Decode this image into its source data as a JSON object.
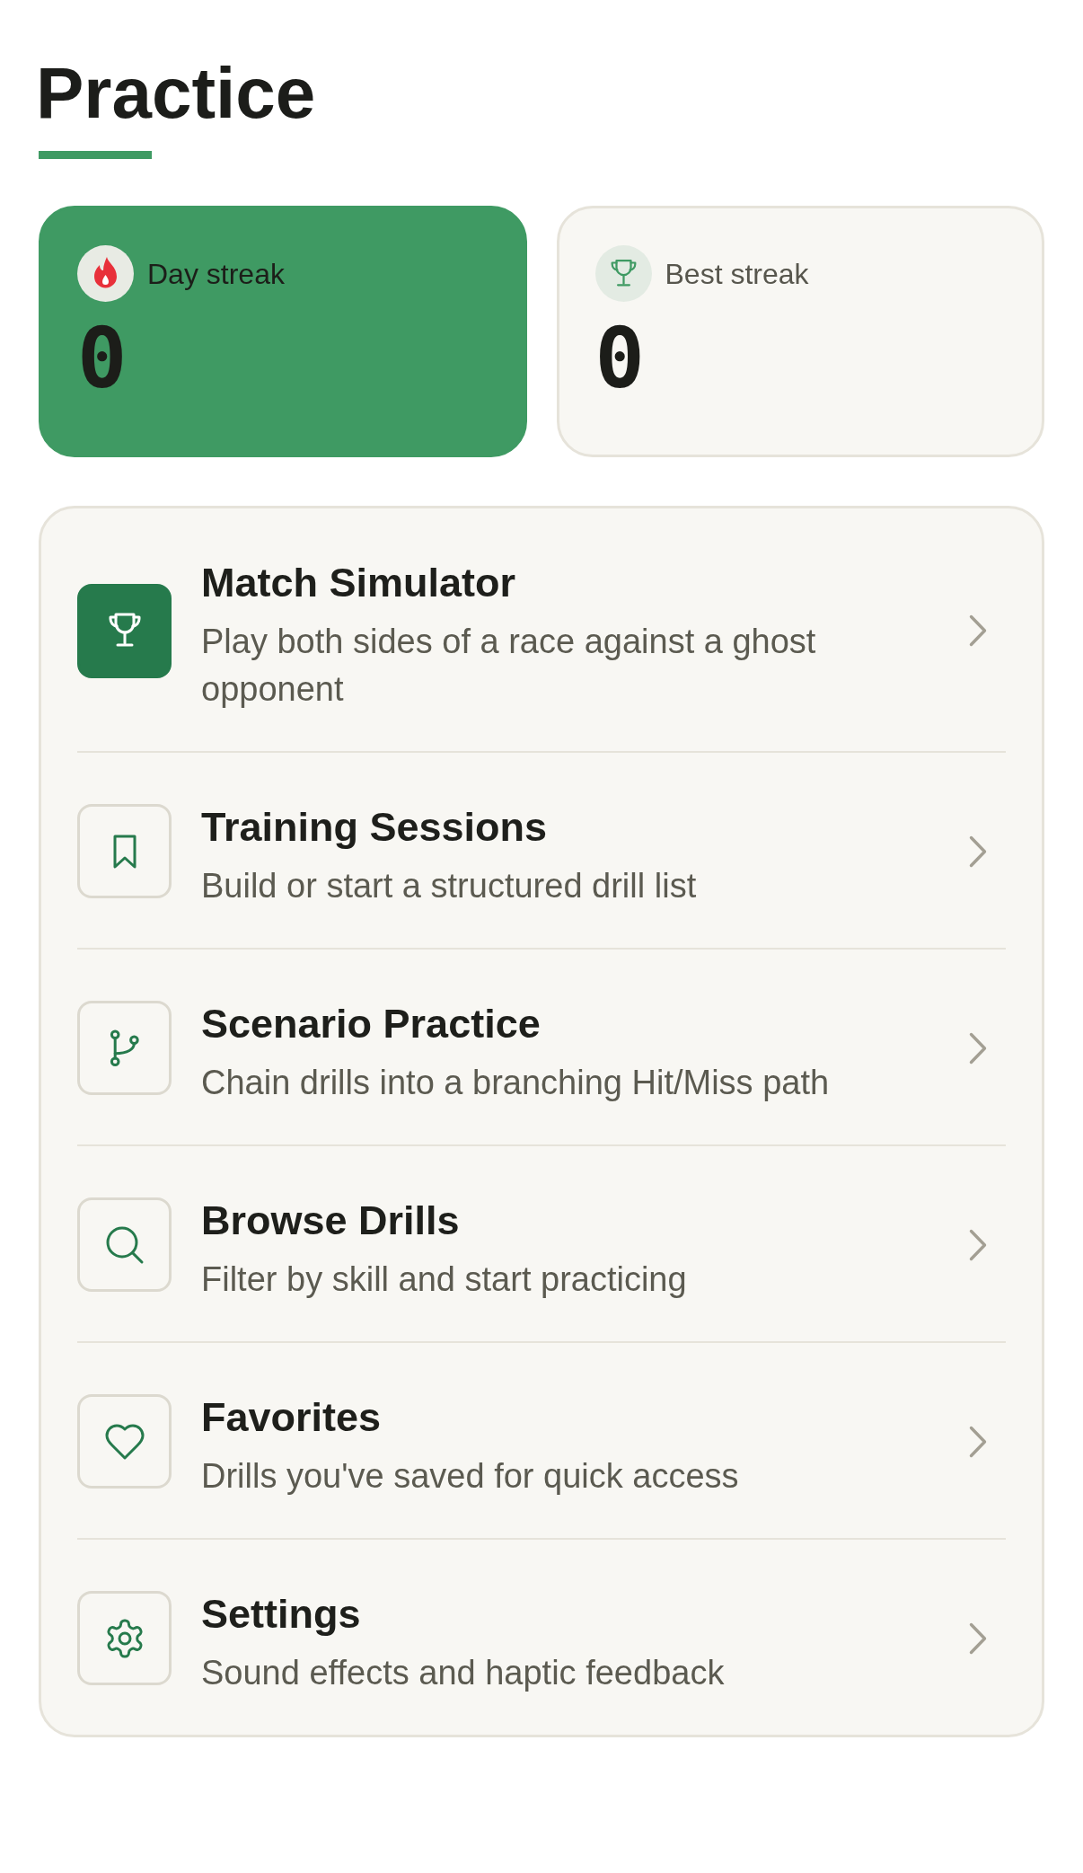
{
  "title": "Practice",
  "stats": [
    {
      "label": "Day streak",
      "value": "0",
      "highlighted": true
    },
    {
      "label": "Best streak",
      "value": "0",
      "highlighted": false
    }
  ],
  "menu": [
    {
      "title": "Match Simulator",
      "description": "Play both sides of a race against a ghost opponent",
      "highlighted": true
    },
    {
      "title": "Training Sessions",
      "description": "Build or start a structured drill list",
      "highlighted": false
    },
    {
      "title": "Scenario Practice",
      "description": "Chain drills into a branching Hit/Miss path",
      "highlighted": false
    },
    {
      "title": "Browse Drills",
      "description": "Filter by skill and start practicing",
      "highlighted": false
    },
    {
      "title": "Favorites",
      "description": "Drills you've saved for quick access",
      "highlighted": false
    },
    {
      "title": "Settings",
      "description": "Sound effects and haptic feedback",
      "highlighted": false
    }
  ]
}
